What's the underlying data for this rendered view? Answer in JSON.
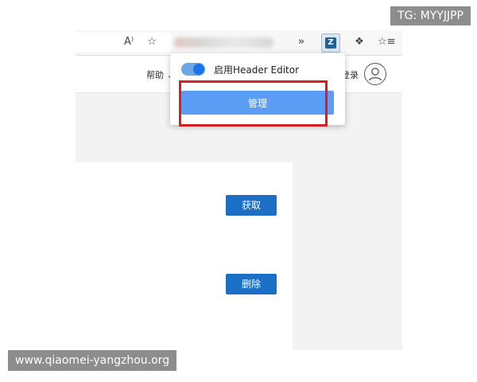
{
  "browser": {
    "icons": [
      "read-aloud-icon",
      "add-favorite-icon",
      "forward-arrows-icon",
      "header-editor-extension-icon",
      "extensions-icon",
      "favorites-icon"
    ],
    "extension_badge": "Z"
  },
  "site": {
    "nav_help": "帮助",
    "nav_login": "登录",
    "buttons": {
      "fetch": "获取",
      "delete": "删除"
    }
  },
  "popup": {
    "toggle_label": "启用Header Editor",
    "toggle_on": true,
    "manage_button": "管理"
  },
  "colors": {
    "accent": "#1b6fc6",
    "manage_button": "#5b9cf5",
    "highlight_box": "#d42020",
    "toggle": "#1a73e8"
  },
  "watermarks": {
    "top": "TG: MYYJJPP",
    "bottom": "www.qiaomei-yangzhou.org"
  }
}
